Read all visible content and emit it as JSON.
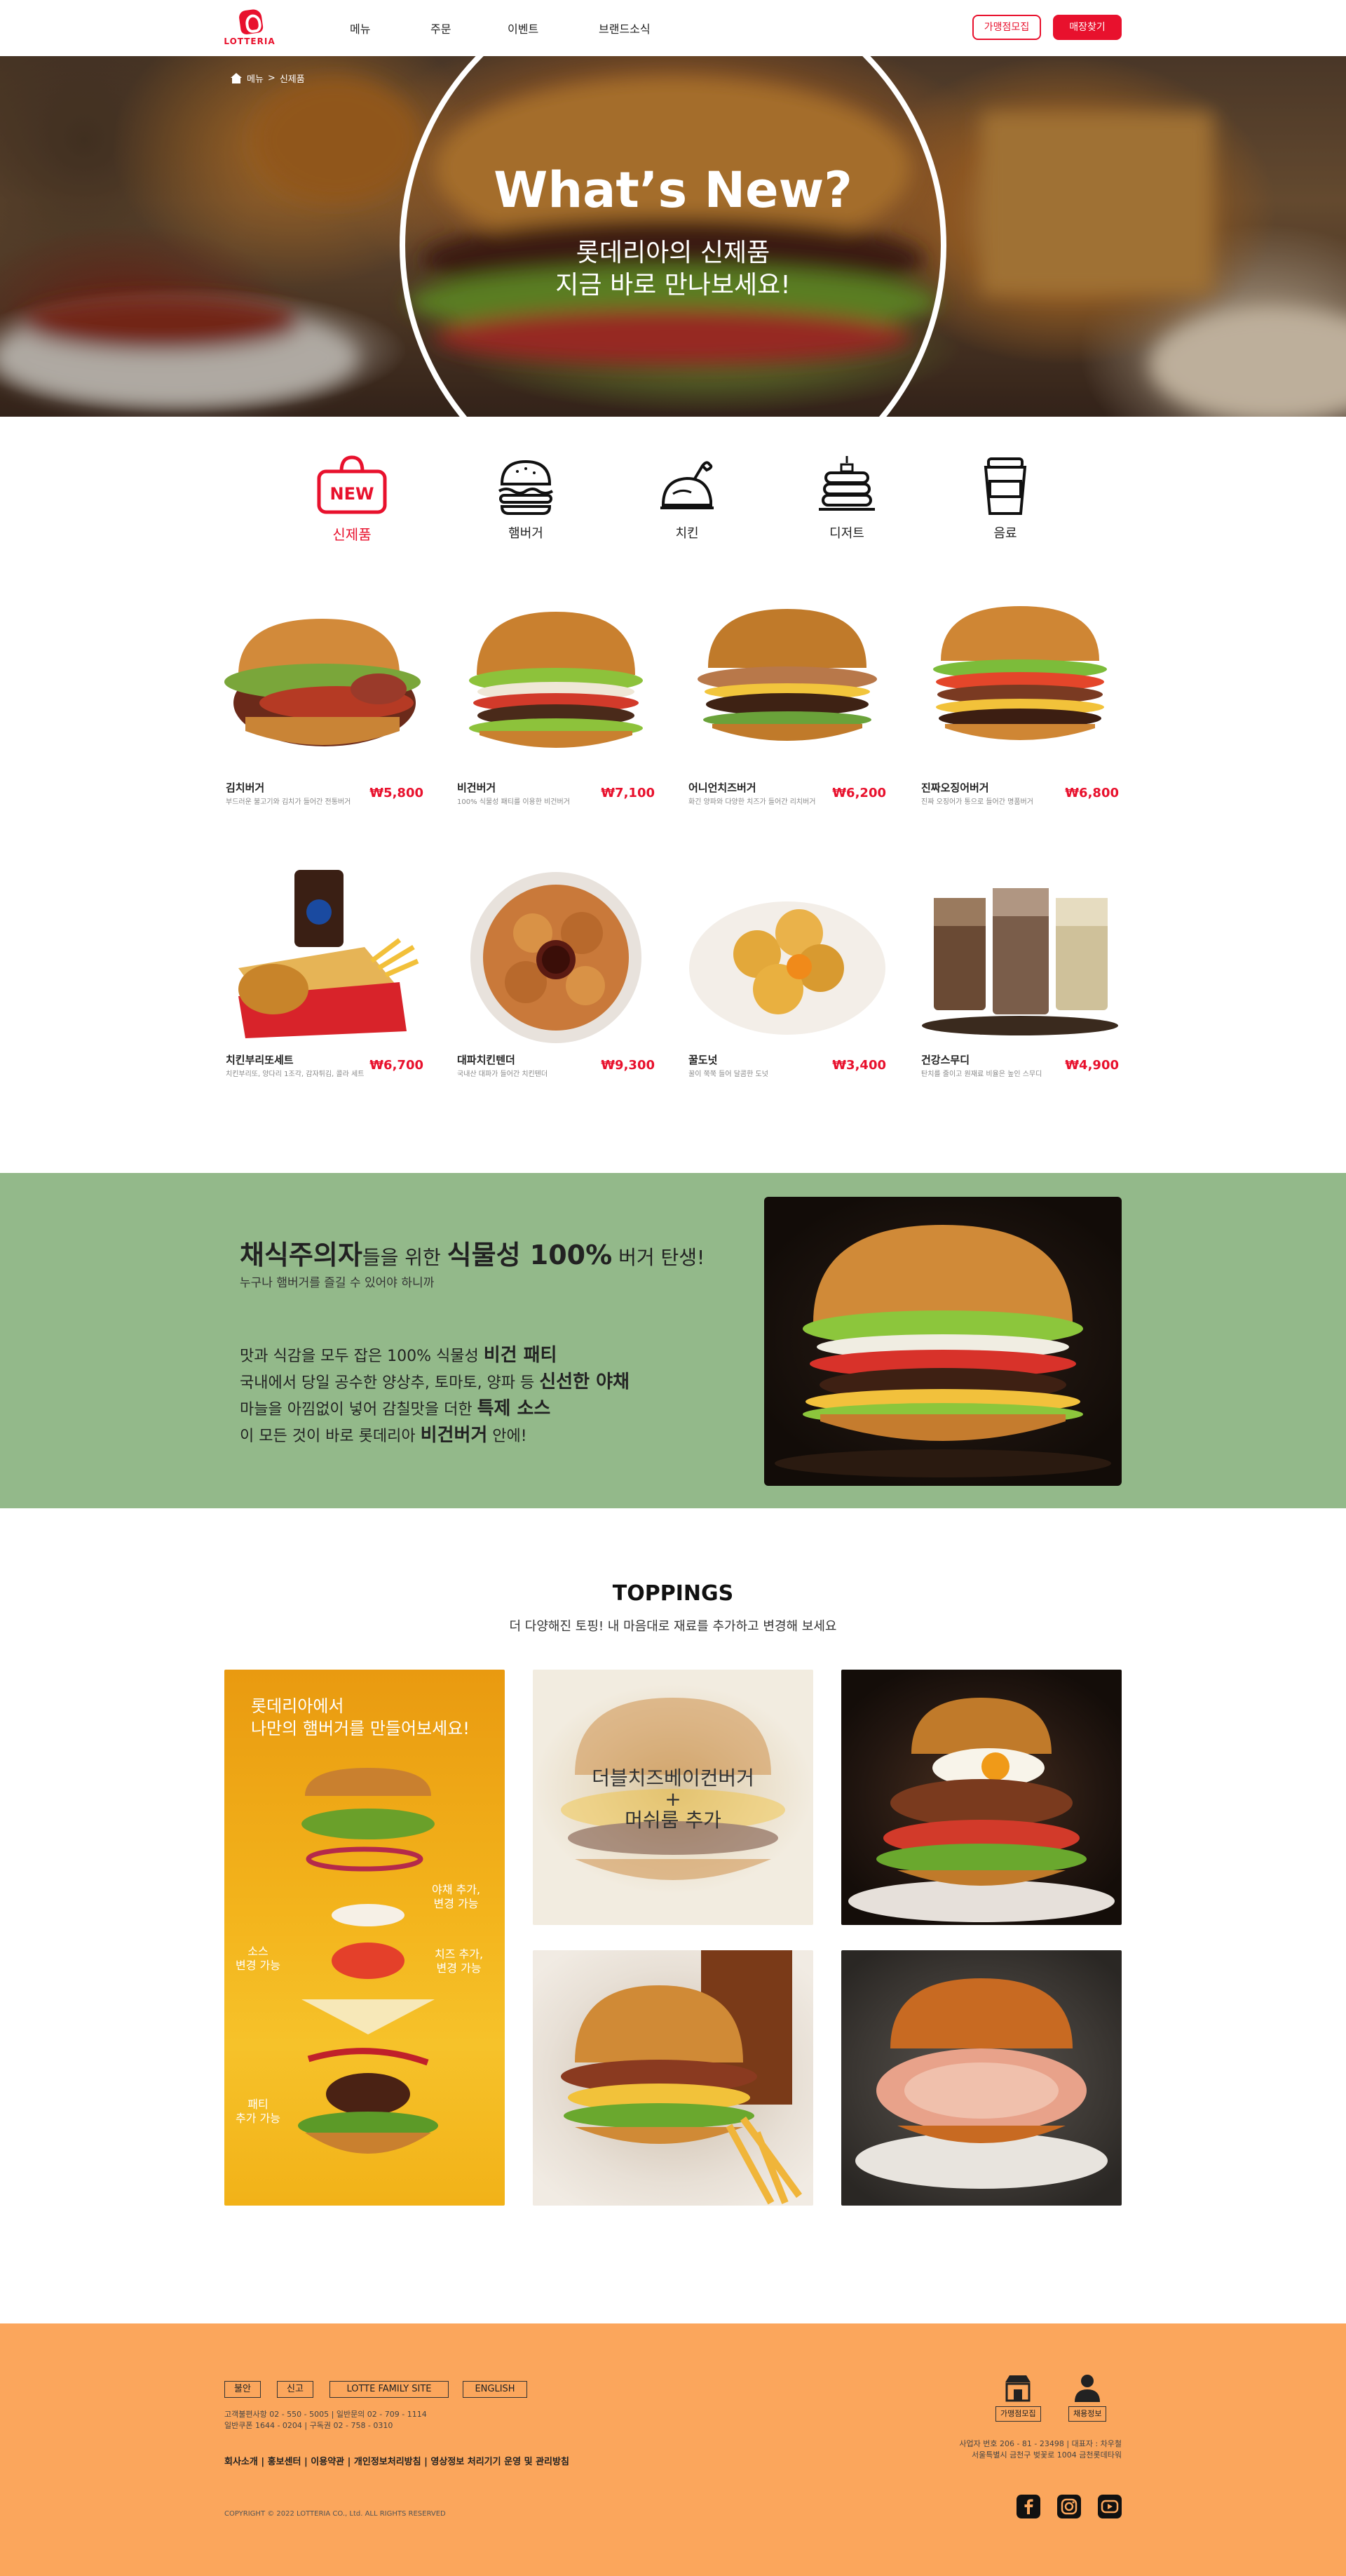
{
  "header": {
    "logo_text": "LOTTERIA",
    "nav": [
      "메뉴",
      "주문",
      "이벤트",
      "브랜드소식"
    ],
    "btn_franchise": "가맹점모집",
    "btn_store": "매장찾기"
  },
  "hero": {
    "breadcrumb_home": "메뉴",
    "breadcrumb_sep": ">",
    "breadcrumb_current": "신제품",
    "title": "What’s New?",
    "sub1": "롯데리아의 신제품",
    "sub2": "지금 바로 만나보세요!"
  },
  "categories": [
    {
      "label": "신제품",
      "icon": "new-icon"
    },
    {
      "label": "햄버거",
      "icon": "burger-icon"
    },
    {
      "label": "치킨",
      "icon": "chicken-icon"
    },
    {
      "label": "디저트",
      "icon": "dessert-icon"
    },
    {
      "label": "음료",
      "icon": "drink-icon"
    }
  ],
  "products": [
    {
      "name": "김치버거",
      "desc": "부드러운 불고기와 김치가 들어간 전통버거",
      "price": "₩5,800"
    },
    {
      "name": "비건버거",
      "desc": "100% 식물성 패티를 이용한 비건버거",
      "price": "₩7,100"
    },
    {
      "name": "어니언치즈버거",
      "desc": "화긴 양파와 다양한 치즈가 들어간 리치버거",
      "price": "₩6,200"
    },
    {
      "name": "진짜오징어버거",
      "desc": "진짜 오징어가 통으로 들어간 명품버거",
      "price": "₩6,800"
    },
    {
      "name": "치킨부리또세트",
      "desc": "치킨부리또, 양다리 1조각, 감자튀김, 콜라 세트",
      "price": "₩6,700"
    },
    {
      "name": "대파치킨텐더",
      "desc": "국내산 대파가 들어간 치킨텐더",
      "price": "₩9,300"
    },
    {
      "name": "꿀도넛",
      "desc": "꿀이 쭉쭉 들어 달콤한 도넛",
      "price": "₩3,400"
    },
    {
      "name": "건강스무디",
      "desc": "탄치를 줄이고 원재료 비율은 높인 스무디",
      "price": "₩4,900"
    }
  ],
  "vegan": {
    "t_a": "채식주의자",
    "t_b": "들을 위한 ",
    "t_c": "식물성 100%",
    "t_d": " 버거 탄생!",
    "t2": "누구나 햄버거를 즐길 수 있어야 하니까",
    "l1a": "맛과 식감을 모두 잡은 100% 식물성 ",
    "l1b": "비건 패티",
    "l2a": "국내에서 당일 공수한 양상추, 토마토, 양파 등 ",
    "l2b": "신선한 야채",
    "l3a": "마늘을 아낌없이 넣어 감칠맛을 더한 ",
    "l3b": "특제 소스",
    "l4a": "이 모든 것이 바로 롯데리아 ",
    "l4b": "비건버거",
    "l4c": " 안에!"
  },
  "toppings": {
    "title": "TOPPINGS",
    "sub": "더 다양해진 토핑! 내 마음대로 재료를 추가하고 변경해 보세요",
    "left_head1": "롯데리아에서",
    "left_head2": "나만의 햄버거를 만들어보세요!",
    "note_veg1": "야채 추가,",
    "note_veg2": "변경 가능",
    "note_sauce1": "소스",
    "note_sauce2": "변경 가능",
    "note_cheese1": "치즈 추가,",
    "note_cheese2": "변경 가능",
    "note_patty1": "패티",
    "note_patty2": "추가 가능",
    "overlay1": "더블치즈베이컨버거",
    "overlay_plus": "+",
    "overlay2": "머쉬룸 추가"
  },
  "footer": {
    "btns": [
      "불안",
      "신고",
      "LOTTE FAMILY SITE",
      "ENGLISH"
    ],
    "info1": "고객불편사항 02 - 550 - 5005  |  일반문의 02 - 709 - 1114",
    "info2": "일반쿠폰 1644 - 0204 | 구독권 02 - 758 - 0310",
    "links": "회사소개 | 홍보센터 | 이용약관 | 개인정보처리방침 | 영상정보 처리기기 운영 및 관리방침",
    "copy": "COPYRIGHT © 2022 LOTTERIA CO., Ltd. ALL RIGHTS RESERVED",
    "icon1": "가맹점모집",
    "icon2": "채용정보",
    "addr1": "사업자 번호 206 - 81 - 23498 | 대표자 : 차우철",
    "addr2": "서울특별시 금천구 벚꽃로 1004 금천롯데타워"
  },
  "colors": {
    "brand": "#e8112d",
    "vegan_bg": "#93b98a",
    "footer_bg": "#fba65c"
  }
}
